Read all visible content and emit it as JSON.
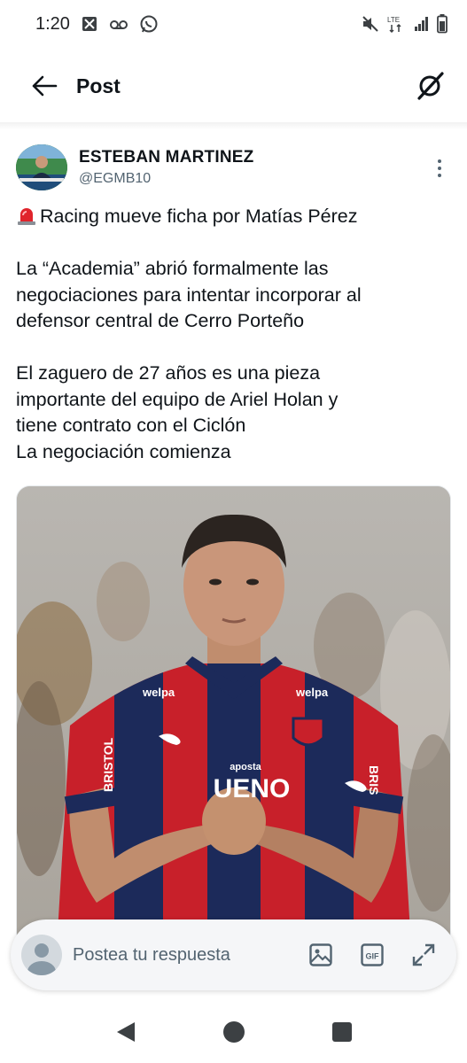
{
  "status_bar": {
    "time": "1:20",
    "network_label": "LTE"
  },
  "header": {
    "title": "Post",
    "back_icon": "arrow-left-icon",
    "grok_icon": "grok-icon"
  },
  "post": {
    "author_name": "ESTEBAN MARTINEZ",
    "author_handle": "@EGMB10",
    "line1": "Racing mueve ficha por Matías Pérez",
    "paragraph1": [
      "La “Academia” abrió formalmente las",
      "negociaciones para intentar incorporar al",
      "defensor central de Cerro Porteño"
    ],
    "paragraph2": [
      "El zaguero de 27 años es una pieza",
      "importante del equipo de Ariel Holan y",
      "tiene contrato con el Ciclón",
      "La negociación comienza"
    ],
    "media": {
      "jersey_sponsor": "UENO",
      "jersey_brand_left": "BRISTOL",
      "jersey_brand_right": "BRIS",
      "sleeve_sponsor": "welpa",
      "chest_small": "aposta"
    }
  },
  "composer": {
    "placeholder": "Postea tu respuesta",
    "gif_label": "GIF"
  },
  "colors": {
    "text_primary": "#0f1419",
    "text_secondary": "#536471",
    "jersey_red": "#c8202a",
    "jersey_navy": "#1c2a5a"
  }
}
